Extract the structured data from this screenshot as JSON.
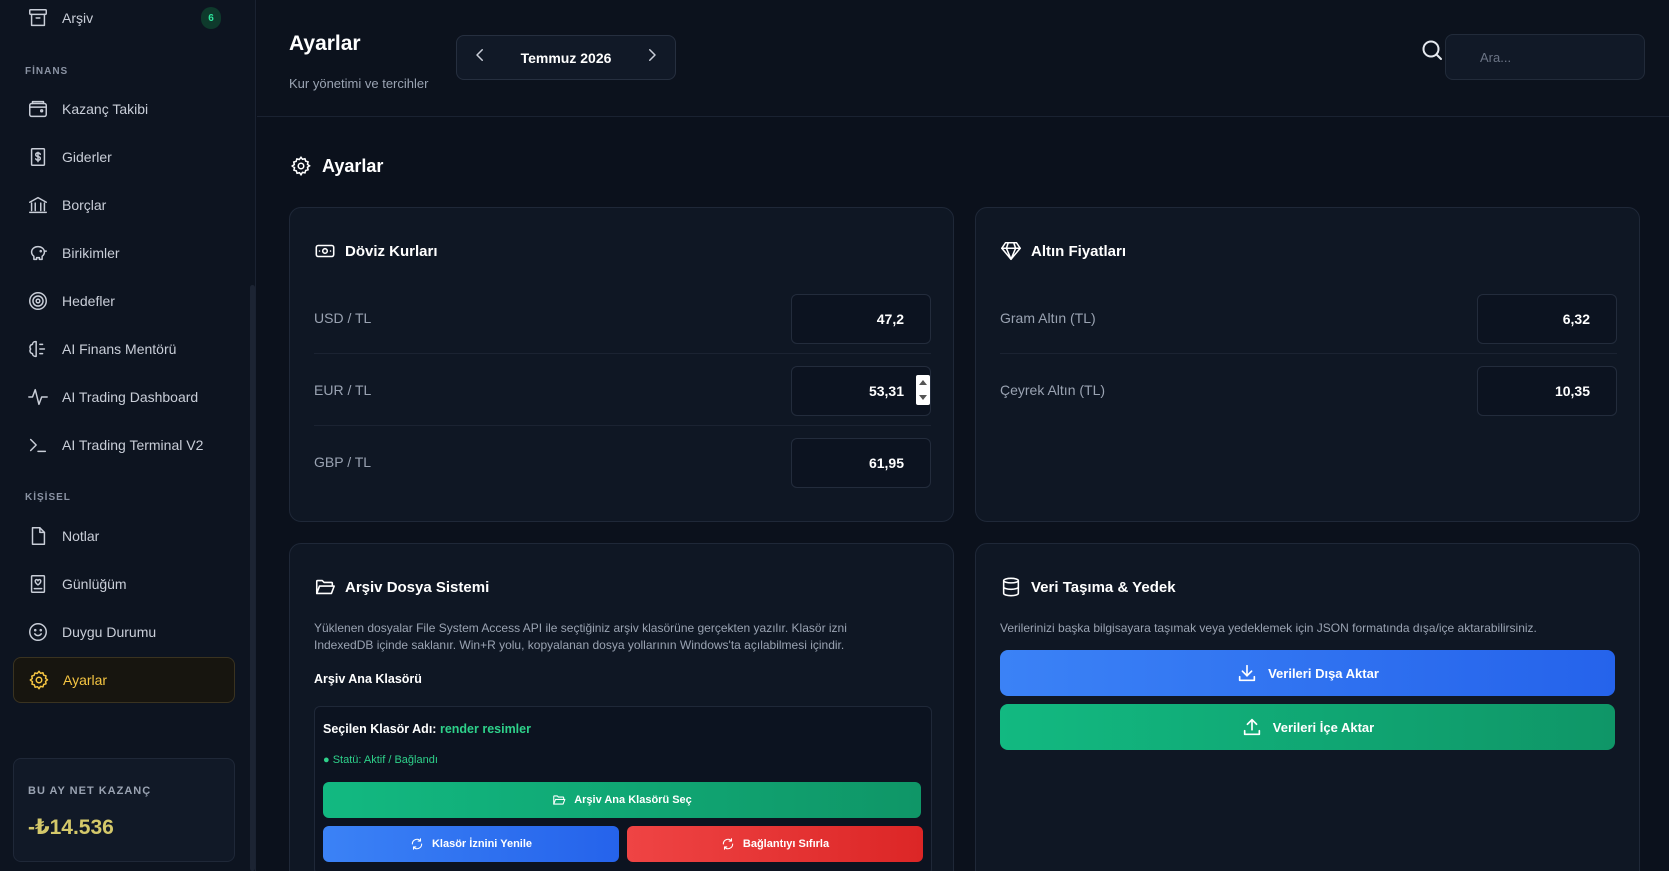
{
  "sidebar": {
    "archive": {
      "label": "Arşiv",
      "badge": "6"
    },
    "sections": {
      "finance": "FİNANS",
      "personal": "KİŞİSEL"
    },
    "items": [
      {
        "label": "Kazanç Takibi",
        "icon": "wallet-icon"
      },
      {
        "label": "Giderler",
        "icon": "receipt-icon"
      },
      {
        "label": "Borçlar",
        "icon": "bank-icon"
      },
      {
        "label": "Birikimler",
        "icon": "piggy-bank-icon"
      },
      {
        "label": "Hedefler",
        "icon": "target-icon"
      },
      {
        "label": "AI Finans Mentörü",
        "icon": "brain-icon"
      },
      {
        "label": "AI Trading Dashboard",
        "icon": "activity-icon"
      },
      {
        "label": "AI Trading Terminal V2",
        "icon": "terminal-icon"
      },
      {
        "label": "Notlar",
        "icon": "file-icon"
      },
      {
        "label": "Günlüğüm",
        "icon": "journal-icon"
      },
      {
        "label": "Duygu Durumu",
        "icon": "smile-icon"
      },
      {
        "label": "Ayarlar",
        "icon": "gear-icon",
        "active": true
      }
    ],
    "net_card": {
      "label": "BU AY NET KAZANÇ",
      "value": "-₺14.536"
    }
  },
  "header": {
    "title": "Ayarlar",
    "subtitle": "Kur yönetimi ve tercihler",
    "month": "Temmuz 2026",
    "search_placeholder": "Ara..."
  },
  "main": {
    "title": "Ayarlar",
    "currency": {
      "title": "Döviz Kurları",
      "rows": [
        {
          "label": "USD / TL",
          "value": "47,2"
        },
        {
          "label": "EUR / TL",
          "value": "53,31"
        },
        {
          "label": "GBP / TL",
          "value": "61,95"
        }
      ]
    },
    "gold": {
      "title": "Altın Fiyatları",
      "rows": [
        {
          "label": "Gram Altın (TL)",
          "value": "6,32"
        },
        {
          "label": "Çeyrek Altın (TL)",
          "value": "10,35"
        }
      ]
    },
    "archive_fs": {
      "title": "Arşiv Dosya Sistemi",
      "desc1": "Yüklenen dosyalar File System Access API ile seçtiğiniz arşiv klasörüne gerçekten yazılır. Klasör izni",
      "desc2": "IndexedDB içinde saklanır. Win+R yolu, kopyalanan dosya yollarının Windows'ta açılabilmesi içindir.",
      "root_label": "Arşiv Ana Klasörü",
      "selected_label": "Seçilen Klasör Adı:",
      "selected_value": "render resimler",
      "status": "● Statü: Aktif / Bağlandı",
      "choose_btn": "Arşiv Ana Klasörü Seç",
      "refresh_btn": "Klasör İznini Yenile",
      "reset_btn": "Bağlantıyı Sıfırla"
    },
    "data_transfer": {
      "title": "Veri Taşıma & Yedek",
      "desc": "Verilerinizi başka bilgisayara taşımak veya yedeklemek için JSON formatında dışa/içe aktarabilirsiniz.",
      "export_btn": "Verileri Dışa Aktar",
      "import_btn": "Verileri İçe Aktar"
    }
  },
  "colors": {
    "accent": "#f5c542",
    "green": "#12b981",
    "blue": "#3b82f6",
    "red": "#ef4444"
  }
}
